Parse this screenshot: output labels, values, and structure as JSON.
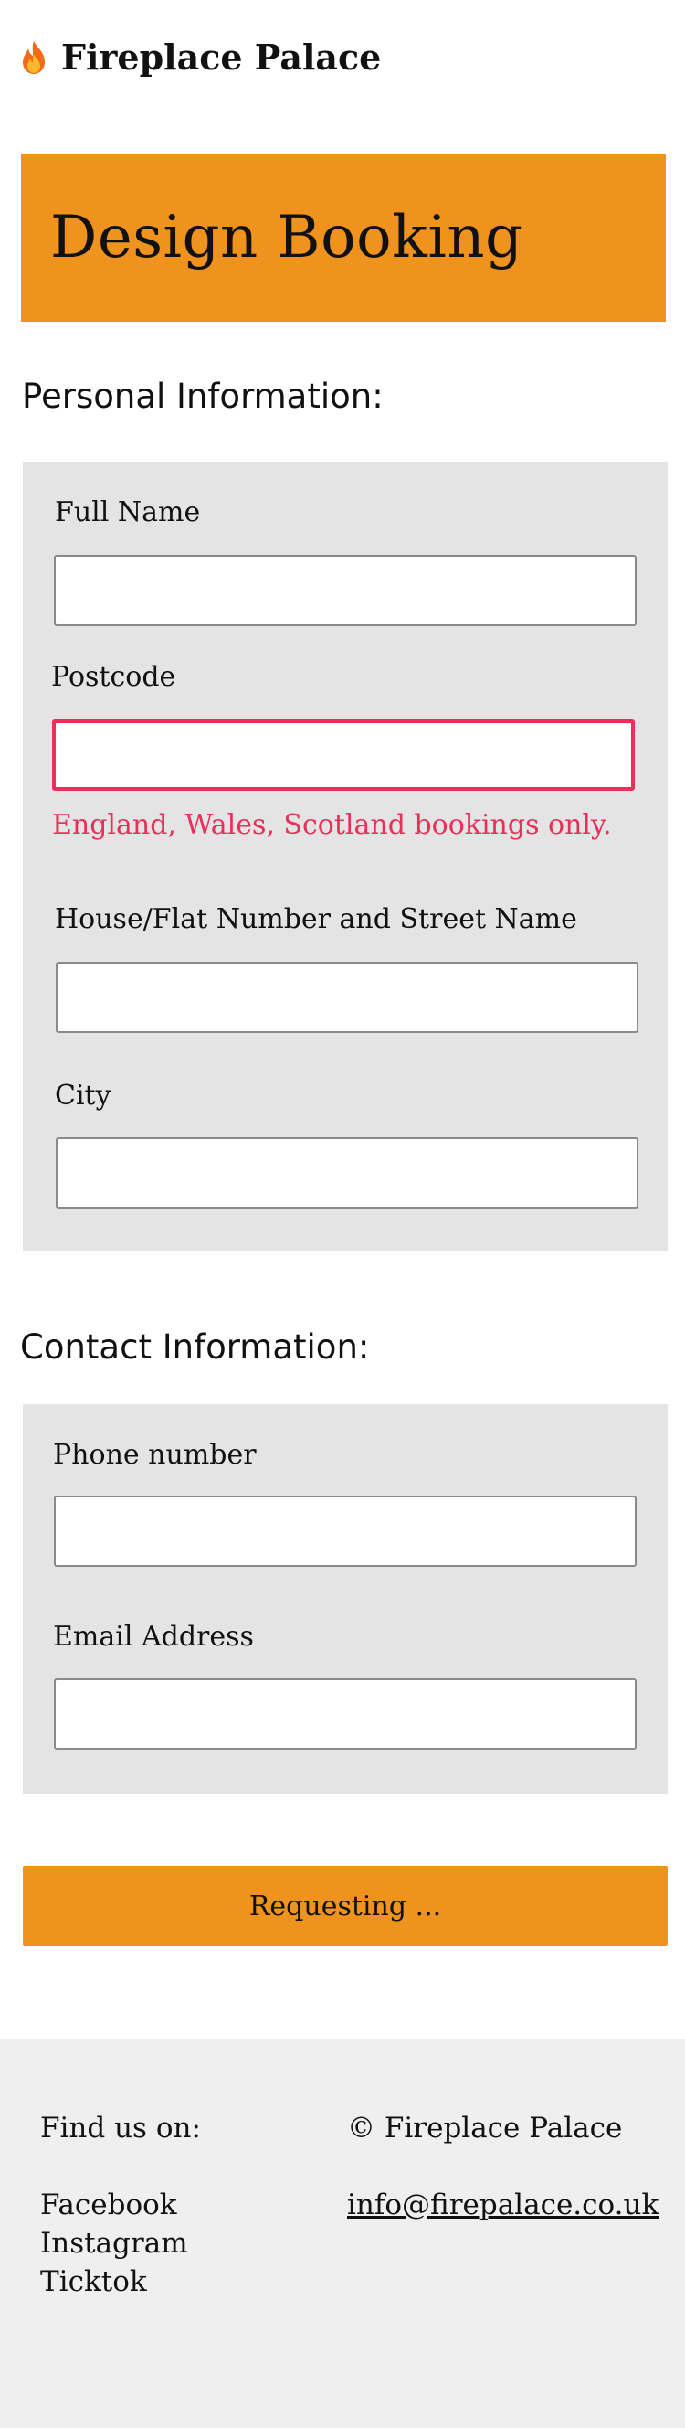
{
  "header": {
    "brand": "Fireplace Palace",
    "icon": "flame-icon"
  },
  "hero": {
    "title": "Design Booking",
    "background": "#f0931e"
  },
  "personal": {
    "heading": "Personal Information:",
    "full_name": {
      "label": "Full Name",
      "value": ""
    },
    "postcode": {
      "label": "Postcode",
      "value": "",
      "error": "England, Wales, Scotland bookings only."
    },
    "street": {
      "label": "House/Flat Number and Street Name",
      "value": ""
    },
    "city": {
      "label": "City",
      "value": ""
    }
  },
  "contact": {
    "heading": "Contact Information:",
    "phone": {
      "label": "Phone number",
      "value": ""
    },
    "email": {
      "label": "Email Address",
      "value": ""
    }
  },
  "submit": {
    "label": "Requesting ..."
  },
  "footer": {
    "find_us": "Find us on:",
    "socials": [
      "Facebook",
      "Instagram",
      "Ticktok"
    ],
    "copyright": "© Fireplace Palace",
    "email": "info@firepalace.co.uk"
  },
  "colors": {
    "accent": "#f0931e",
    "error": "#e8305a",
    "panel": "#e4e4e4",
    "footer": "#efefef"
  }
}
